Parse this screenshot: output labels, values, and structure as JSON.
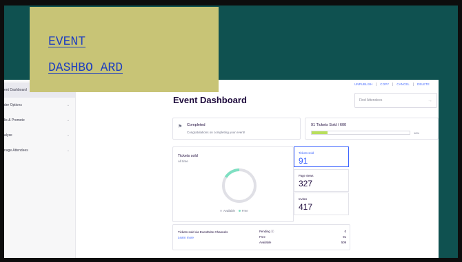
{
  "slide": {
    "title_line1": "EVENT",
    "title_line2": "DASHBO ARD"
  },
  "sidebar": {
    "items": [
      {
        "label": "ent Dashboard"
      },
      {
        "label": "der Options"
      },
      {
        "label": "lis & Promote"
      },
      {
        "label": "alyze"
      },
      {
        "label": "nage Attendees"
      }
    ]
  },
  "top_actions": [
    "UNPUBLISH",
    "COPY",
    "CANCEL",
    "DELETE"
  ],
  "page_title": "Event Dashboard",
  "search": {
    "placeholder": "Find Attendees"
  },
  "status": {
    "title": "Completed",
    "message": "Congratulations on completing your event!"
  },
  "tickets_progress": {
    "label": "91 Tickets Sold / 600",
    "percent_label": "16%",
    "fraction": 0.16
  },
  "tickets_chart": {
    "title": "Tickets sold",
    "subtitle": "All time",
    "legend_available": "Available",
    "legend_free": "Free",
    "colors": {
      "ring": "#e0e0e6",
      "free": "#7fe0c2"
    }
  },
  "stats": [
    {
      "label": "Tickets sold",
      "value": "91"
    },
    {
      "label": "Page views",
      "value": "327"
    },
    {
      "label": "Invites",
      "value": "417"
    }
  ],
  "channels": {
    "title": "Tickets sold via Eventbrite Channels",
    "link": "Learn more",
    "rows": [
      {
        "label": "Pending ⓘ",
        "value": "0"
      },
      {
        "label": "Free",
        "value": "91"
      },
      {
        "label": "Available",
        "value": "509"
      }
    ]
  }
}
